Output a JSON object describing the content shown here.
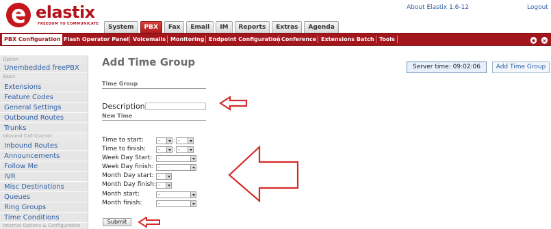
{
  "header": {
    "logo_word": "elastix",
    "logo_tagline": "FREEDOM TO COMMUNICATE",
    "about_label": "About Elastix 1.6-12",
    "logout_label": "Logout",
    "tabs": [
      {
        "label": "System"
      },
      {
        "label": "PBX"
      },
      {
        "label": "Fax"
      },
      {
        "label": "Email"
      },
      {
        "label": "IM"
      },
      {
        "label": "Reports"
      },
      {
        "label": "Extras"
      },
      {
        "label": "Agenda"
      }
    ],
    "active_tab": "PBX"
  },
  "menubar": {
    "items": [
      {
        "label": "PBX Configuration"
      },
      {
        "label": "Flash Operator Panel"
      },
      {
        "label": "Voicemails"
      },
      {
        "label": "Monitoring"
      },
      {
        "label": "Endpoint Configuration"
      },
      {
        "label": "Conference"
      },
      {
        "label": "Extensions Batch"
      },
      {
        "label": "Tools"
      }
    ],
    "active_item": "PBX Configuration",
    "right_icons": [
      "help-icon",
      "close-icon"
    ]
  },
  "sidebar": {
    "rows": [
      {
        "kind": "category",
        "label": "Option"
      },
      {
        "kind": "link",
        "label": "Unembedded freePBX"
      },
      {
        "kind": "category",
        "label": "Basic"
      },
      {
        "kind": "link",
        "label": "Extensions"
      },
      {
        "kind": "link",
        "label": "Feature Codes"
      },
      {
        "kind": "link",
        "label": "General Settings"
      },
      {
        "kind": "link",
        "label": "Outbound Routes"
      },
      {
        "kind": "link",
        "label": "Trunks"
      },
      {
        "kind": "category",
        "label": "Inbound Call Control"
      },
      {
        "kind": "link",
        "label": "Inbound Routes"
      },
      {
        "kind": "link",
        "label": "Announcements"
      },
      {
        "kind": "link",
        "label": "Follow Me"
      },
      {
        "kind": "link",
        "label": "IVR"
      },
      {
        "kind": "link",
        "label": "Misc Destinations"
      },
      {
        "kind": "link",
        "label": "Queues"
      },
      {
        "kind": "link",
        "label": "Ring Groups"
      },
      {
        "kind": "link",
        "label": "Time Conditions"
      },
      {
        "kind": "category",
        "label": "Internal Options & Configuration"
      }
    ]
  },
  "main": {
    "title": "Add Time Group",
    "server_time_label": "Server time: 09:02:06",
    "add_time_group_button": "Add Time Group",
    "section_time_group": "Time Group",
    "description_label": "Description",
    "description_value": "",
    "section_new_time": "New Time",
    "fields": [
      {
        "label": "Time to start:"
      },
      {
        "label": "Time to finish:"
      },
      {
        "label": "Week Day Start:"
      },
      {
        "label": "Week Day finish:"
      },
      {
        "label": "Month Day start:"
      },
      {
        "label": "Month Day finish:"
      },
      {
        "label": "Month start:"
      },
      {
        "label": "Month finish:"
      }
    ],
    "select_value": "-",
    "submit_label": "Submit"
  },
  "annotations": {
    "arrow_color": "#d42a2a"
  },
  "colors": {
    "brand_red": "#a3161c",
    "link_blue": "#2c5fa5"
  }
}
